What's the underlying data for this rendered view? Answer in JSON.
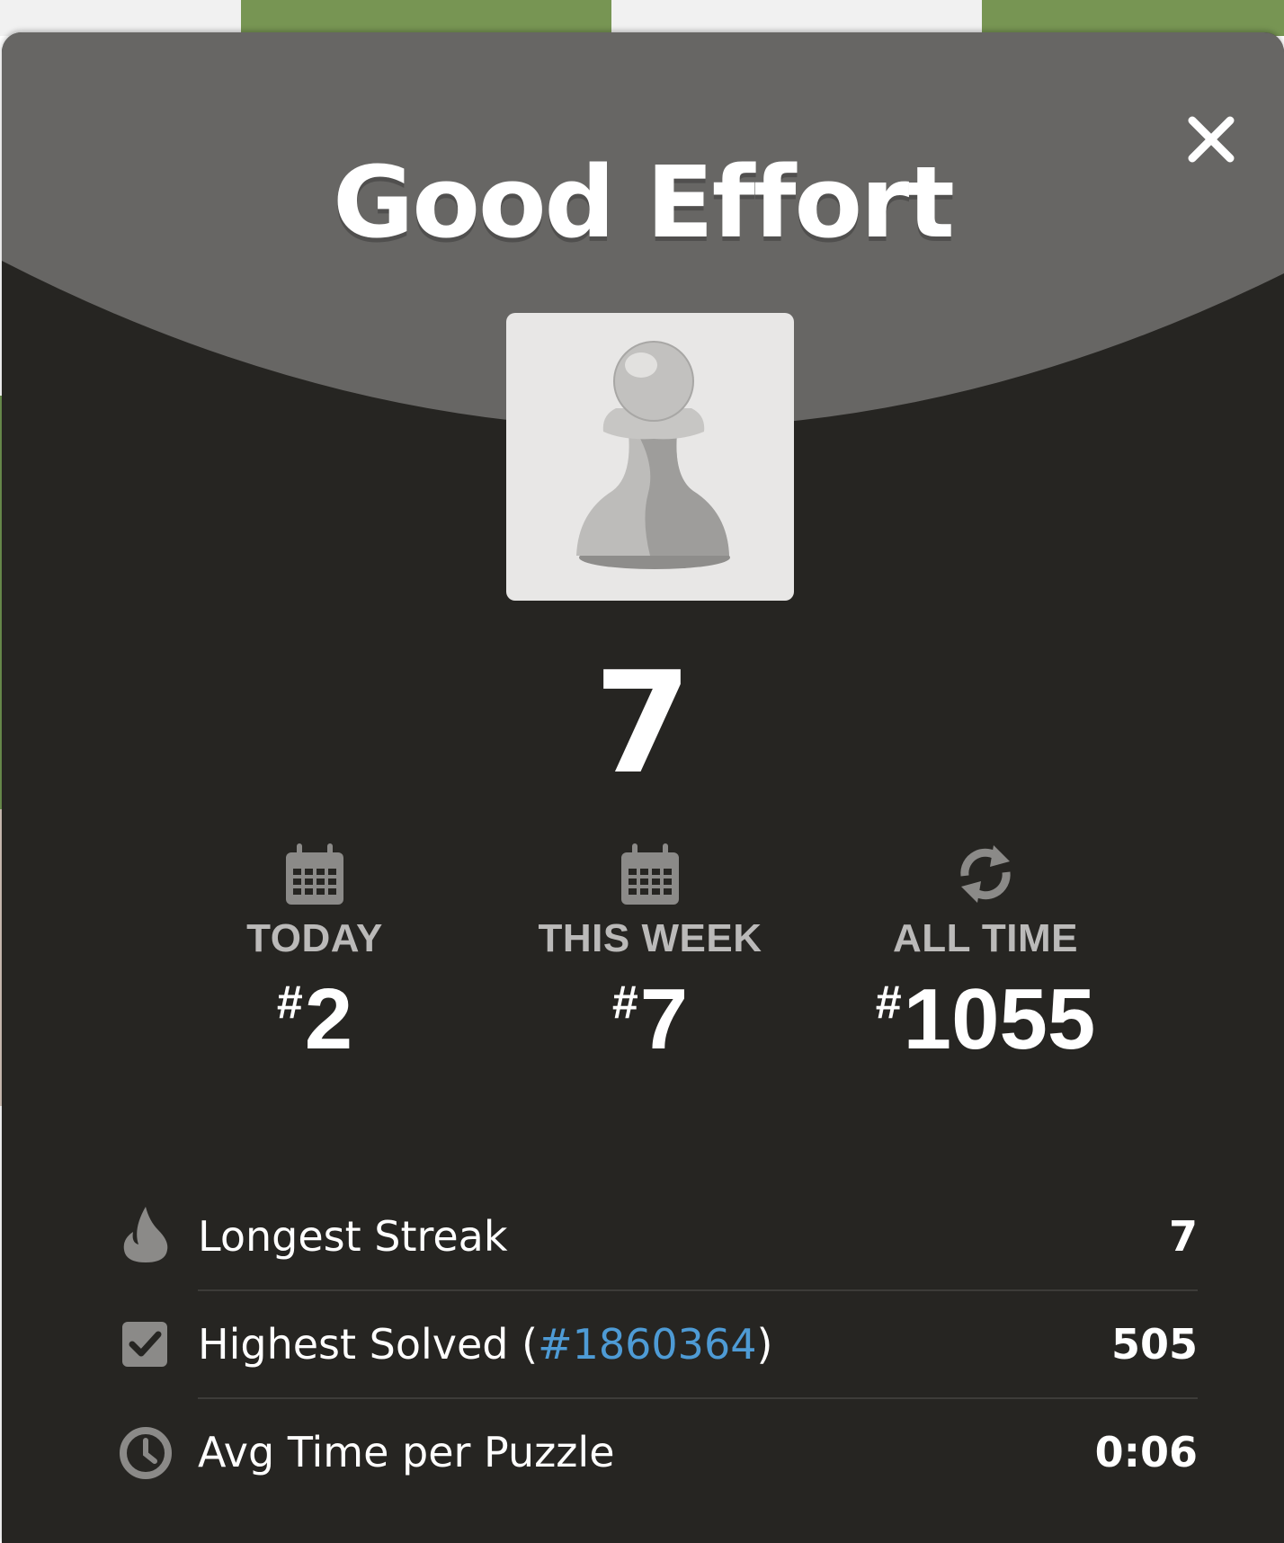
{
  "modal": {
    "title": "Good Effort",
    "close_icon": "close-icon",
    "badge_icon": "pawn-icon",
    "score": "7"
  },
  "ranks": [
    {
      "icon": "calendar-icon",
      "label": "TODAY",
      "hash": "#",
      "value": "2"
    },
    {
      "icon": "calendar-icon",
      "label": "THIS WEEK",
      "hash": "#",
      "value": "7"
    },
    {
      "icon": "refresh-icon",
      "label": "ALL TIME",
      "hash": "#",
      "value": "1055"
    }
  ],
  "stats": [
    {
      "icon": "flame-icon",
      "label": "Longest Streak",
      "value": "7"
    },
    {
      "icon": "checkbox-icon",
      "label_prefix": "Highest Solved (",
      "link": "#1860364",
      "label_suffix": ")",
      "value": "505"
    },
    {
      "icon": "clock-icon",
      "label": "Avg Time per Puzzle",
      "value": "0:06"
    }
  ],
  "colors": {
    "modal_bg": "#262522",
    "header_bg": "#676664",
    "link": "#4e9bd5",
    "muted_text": "#bbbab9",
    "icon_gray": "#8b8a88",
    "background_green": "#6f9350"
  }
}
